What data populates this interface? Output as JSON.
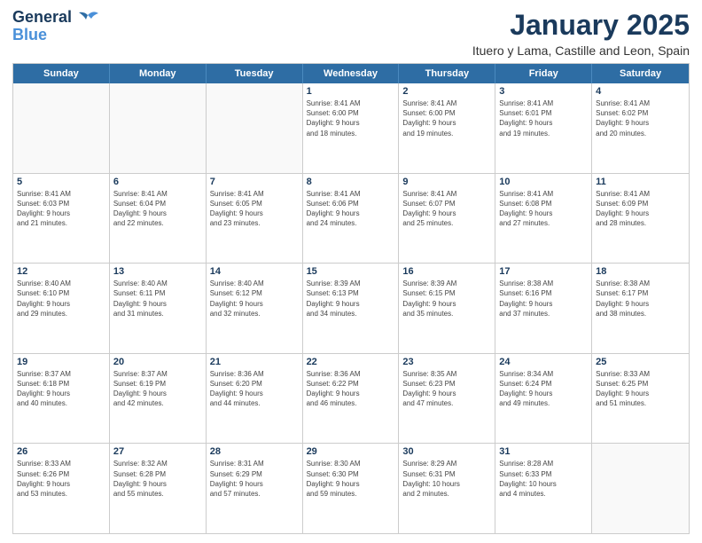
{
  "header": {
    "logo_line1": "General",
    "logo_line2": "Blue",
    "month": "January 2025",
    "location": "Ituero y Lama, Castille and Leon, Spain"
  },
  "weekdays": [
    "Sunday",
    "Monday",
    "Tuesday",
    "Wednesday",
    "Thursday",
    "Friday",
    "Saturday"
  ],
  "rows": [
    [
      {
        "day": "",
        "info": ""
      },
      {
        "day": "",
        "info": ""
      },
      {
        "day": "",
        "info": ""
      },
      {
        "day": "1",
        "info": "Sunrise: 8:41 AM\nSunset: 6:00 PM\nDaylight: 9 hours\nand 18 minutes."
      },
      {
        "day": "2",
        "info": "Sunrise: 8:41 AM\nSunset: 6:00 PM\nDaylight: 9 hours\nand 19 minutes."
      },
      {
        "day": "3",
        "info": "Sunrise: 8:41 AM\nSunset: 6:01 PM\nDaylight: 9 hours\nand 19 minutes."
      },
      {
        "day": "4",
        "info": "Sunrise: 8:41 AM\nSunset: 6:02 PM\nDaylight: 9 hours\nand 20 minutes."
      }
    ],
    [
      {
        "day": "5",
        "info": "Sunrise: 8:41 AM\nSunset: 6:03 PM\nDaylight: 9 hours\nand 21 minutes."
      },
      {
        "day": "6",
        "info": "Sunrise: 8:41 AM\nSunset: 6:04 PM\nDaylight: 9 hours\nand 22 minutes."
      },
      {
        "day": "7",
        "info": "Sunrise: 8:41 AM\nSunset: 6:05 PM\nDaylight: 9 hours\nand 23 minutes."
      },
      {
        "day": "8",
        "info": "Sunrise: 8:41 AM\nSunset: 6:06 PM\nDaylight: 9 hours\nand 24 minutes."
      },
      {
        "day": "9",
        "info": "Sunrise: 8:41 AM\nSunset: 6:07 PM\nDaylight: 9 hours\nand 25 minutes."
      },
      {
        "day": "10",
        "info": "Sunrise: 8:41 AM\nSunset: 6:08 PM\nDaylight: 9 hours\nand 27 minutes."
      },
      {
        "day": "11",
        "info": "Sunrise: 8:41 AM\nSunset: 6:09 PM\nDaylight: 9 hours\nand 28 minutes."
      }
    ],
    [
      {
        "day": "12",
        "info": "Sunrise: 8:40 AM\nSunset: 6:10 PM\nDaylight: 9 hours\nand 29 minutes."
      },
      {
        "day": "13",
        "info": "Sunrise: 8:40 AM\nSunset: 6:11 PM\nDaylight: 9 hours\nand 31 minutes."
      },
      {
        "day": "14",
        "info": "Sunrise: 8:40 AM\nSunset: 6:12 PM\nDaylight: 9 hours\nand 32 minutes."
      },
      {
        "day": "15",
        "info": "Sunrise: 8:39 AM\nSunset: 6:13 PM\nDaylight: 9 hours\nand 34 minutes."
      },
      {
        "day": "16",
        "info": "Sunrise: 8:39 AM\nSunset: 6:15 PM\nDaylight: 9 hours\nand 35 minutes."
      },
      {
        "day": "17",
        "info": "Sunrise: 8:38 AM\nSunset: 6:16 PM\nDaylight: 9 hours\nand 37 minutes."
      },
      {
        "day": "18",
        "info": "Sunrise: 8:38 AM\nSunset: 6:17 PM\nDaylight: 9 hours\nand 38 minutes."
      }
    ],
    [
      {
        "day": "19",
        "info": "Sunrise: 8:37 AM\nSunset: 6:18 PM\nDaylight: 9 hours\nand 40 minutes."
      },
      {
        "day": "20",
        "info": "Sunrise: 8:37 AM\nSunset: 6:19 PM\nDaylight: 9 hours\nand 42 minutes."
      },
      {
        "day": "21",
        "info": "Sunrise: 8:36 AM\nSunset: 6:20 PM\nDaylight: 9 hours\nand 44 minutes."
      },
      {
        "day": "22",
        "info": "Sunrise: 8:36 AM\nSunset: 6:22 PM\nDaylight: 9 hours\nand 46 minutes."
      },
      {
        "day": "23",
        "info": "Sunrise: 8:35 AM\nSunset: 6:23 PM\nDaylight: 9 hours\nand 47 minutes."
      },
      {
        "day": "24",
        "info": "Sunrise: 8:34 AM\nSunset: 6:24 PM\nDaylight: 9 hours\nand 49 minutes."
      },
      {
        "day": "25",
        "info": "Sunrise: 8:33 AM\nSunset: 6:25 PM\nDaylight: 9 hours\nand 51 minutes."
      }
    ],
    [
      {
        "day": "26",
        "info": "Sunrise: 8:33 AM\nSunset: 6:26 PM\nDaylight: 9 hours\nand 53 minutes."
      },
      {
        "day": "27",
        "info": "Sunrise: 8:32 AM\nSunset: 6:28 PM\nDaylight: 9 hours\nand 55 minutes."
      },
      {
        "day": "28",
        "info": "Sunrise: 8:31 AM\nSunset: 6:29 PM\nDaylight: 9 hours\nand 57 minutes."
      },
      {
        "day": "29",
        "info": "Sunrise: 8:30 AM\nSunset: 6:30 PM\nDaylight: 9 hours\nand 59 minutes."
      },
      {
        "day": "30",
        "info": "Sunrise: 8:29 AM\nSunset: 6:31 PM\nDaylight: 10 hours\nand 2 minutes."
      },
      {
        "day": "31",
        "info": "Sunrise: 8:28 AM\nSunset: 6:33 PM\nDaylight: 10 hours\nand 4 minutes."
      },
      {
        "day": "",
        "info": ""
      }
    ]
  ]
}
